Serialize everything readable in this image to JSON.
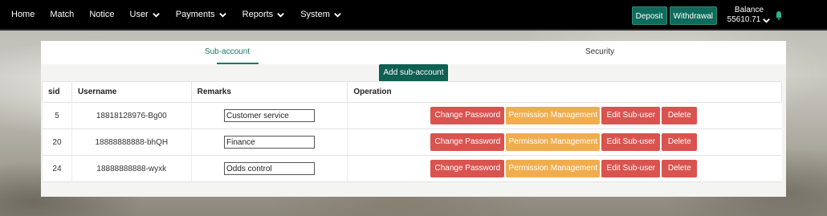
{
  "nav": {
    "items": [
      {
        "label": "Home",
        "has_dropdown": false
      },
      {
        "label": "Match",
        "has_dropdown": false
      },
      {
        "label": "Notice",
        "has_dropdown": false
      },
      {
        "label": "User",
        "has_dropdown": true
      },
      {
        "label": "Payments",
        "has_dropdown": true
      },
      {
        "label": "Reports",
        "has_dropdown": true
      },
      {
        "label": "System",
        "has_dropdown": true
      }
    ],
    "deposit_label": "Deposit",
    "withdrawal_label": "Withdrawal",
    "balance_label": "Balance",
    "balance_value": "55610.71",
    "icons": {
      "dropdown": "chevron-down-icon",
      "notifications": "bell-icon"
    }
  },
  "tabs": [
    {
      "label": "Sub-account",
      "active": true
    },
    {
      "label": "Security",
      "active": false
    }
  ],
  "add_button_label": "Add sub-account",
  "table": {
    "headers": {
      "sid": "sid",
      "username": "Username",
      "remarks": "Remarks",
      "operation": "Operation"
    },
    "rows": [
      {
        "sid": "5",
        "username": "18818128976-Bg00",
        "remark": "Customer service"
      },
      {
        "sid": "20",
        "username": "18888888888-bhQH",
        "remark": "Finance"
      },
      {
        "sid": "24",
        "username": "18888888888-wyxk",
        "remark": "Odds control"
      }
    ],
    "actions": {
      "change_password": "Change Password",
      "permission_management": "Permission Management",
      "edit_sub_user": "Edit Sub-user",
      "delete": "Delete"
    }
  },
  "colors": {
    "topbar": "#000000",
    "accent": "#0f6b5b",
    "danger": "#d9534f",
    "warning": "#f0ad4e"
  }
}
